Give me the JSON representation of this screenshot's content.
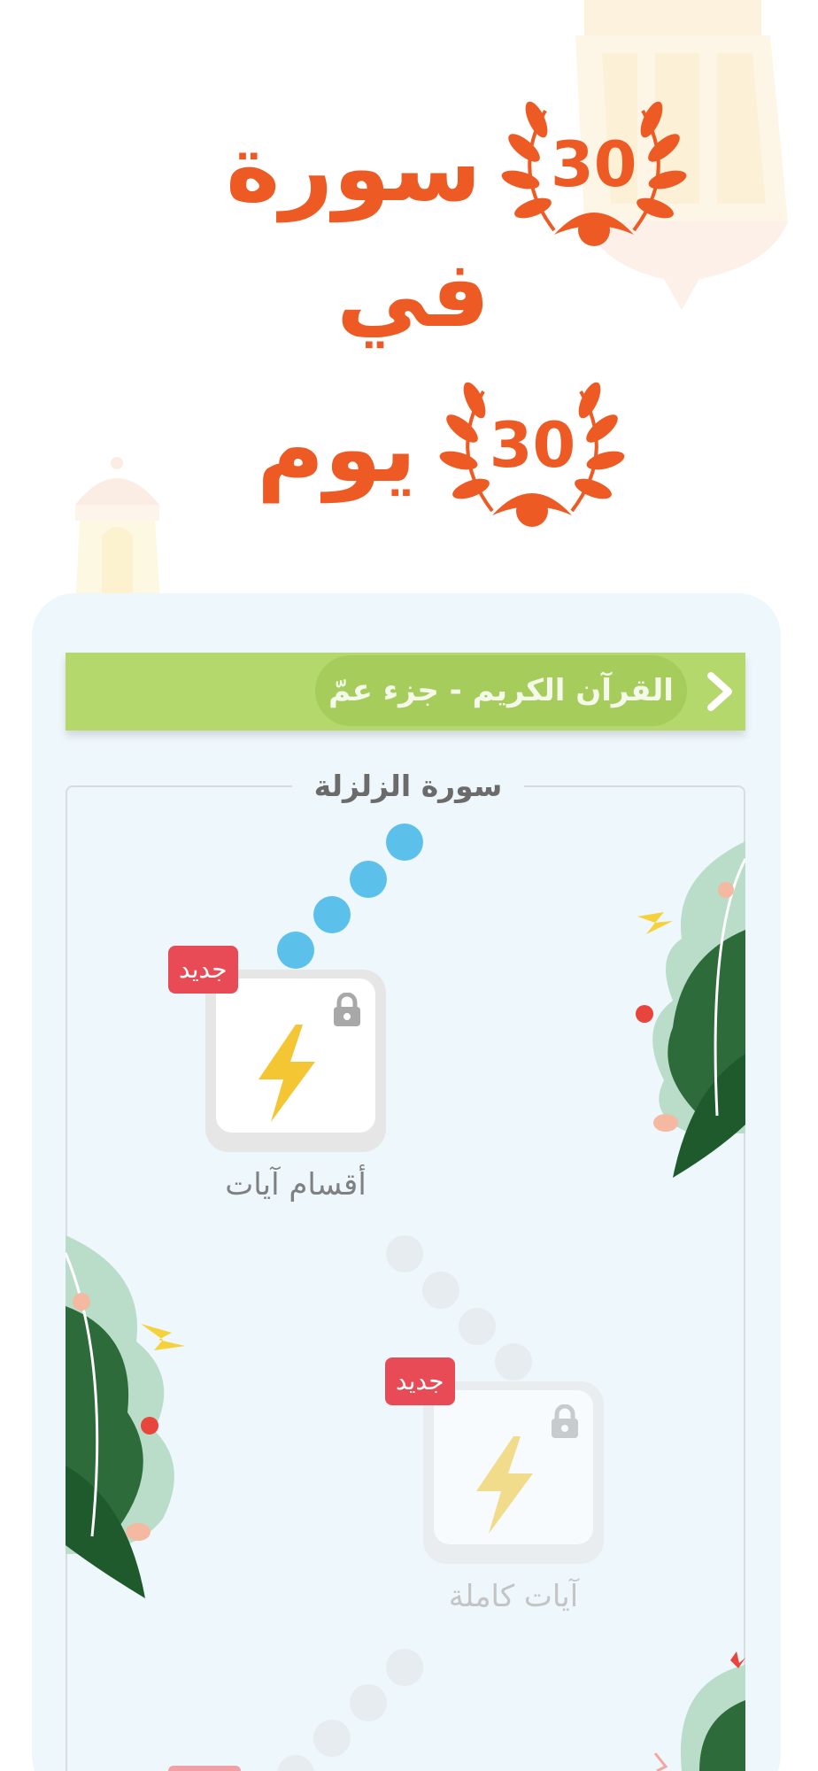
{
  "hero": {
    "line1_word": "سورة",
    "line1_number": "30",
    "line2_word": "في",
    "line3_word": "يوم",
    "line3_number": "30"
  },
  "app": {
    "header_title": "القرآن الكريم - جزء عمّ",
    "section_title": "سورة الزلزلة",
    "lessons": [
      {
        "label": "أقسام آيات",
        "badge": "جديد",
        "icon": "lightning-bolt-icon",
        "locked": true,
        "state": "available"
      },
      {
        "label": "آيات كاملة",
        "badge": "جديد",
        "icon": "lightning-bolt-icon",
        "locked": true,
        "state": "upcoming"
      },
      {
        "label": "",
        "badge": "",
        "icon": "",
        "locked": true,
        "state": "upcoming"
      }
    ]
  },
  "colors": {
    "accent_orange": "#ee5a24",
    "header_green": "#b4d86c",
    "path_blue": "#5bc0ea",
    "badge_red": "#e84b55",
    "bolt_yellow": "#f5c633",
    "panel_bg": "#eef7fb"
  }
}
